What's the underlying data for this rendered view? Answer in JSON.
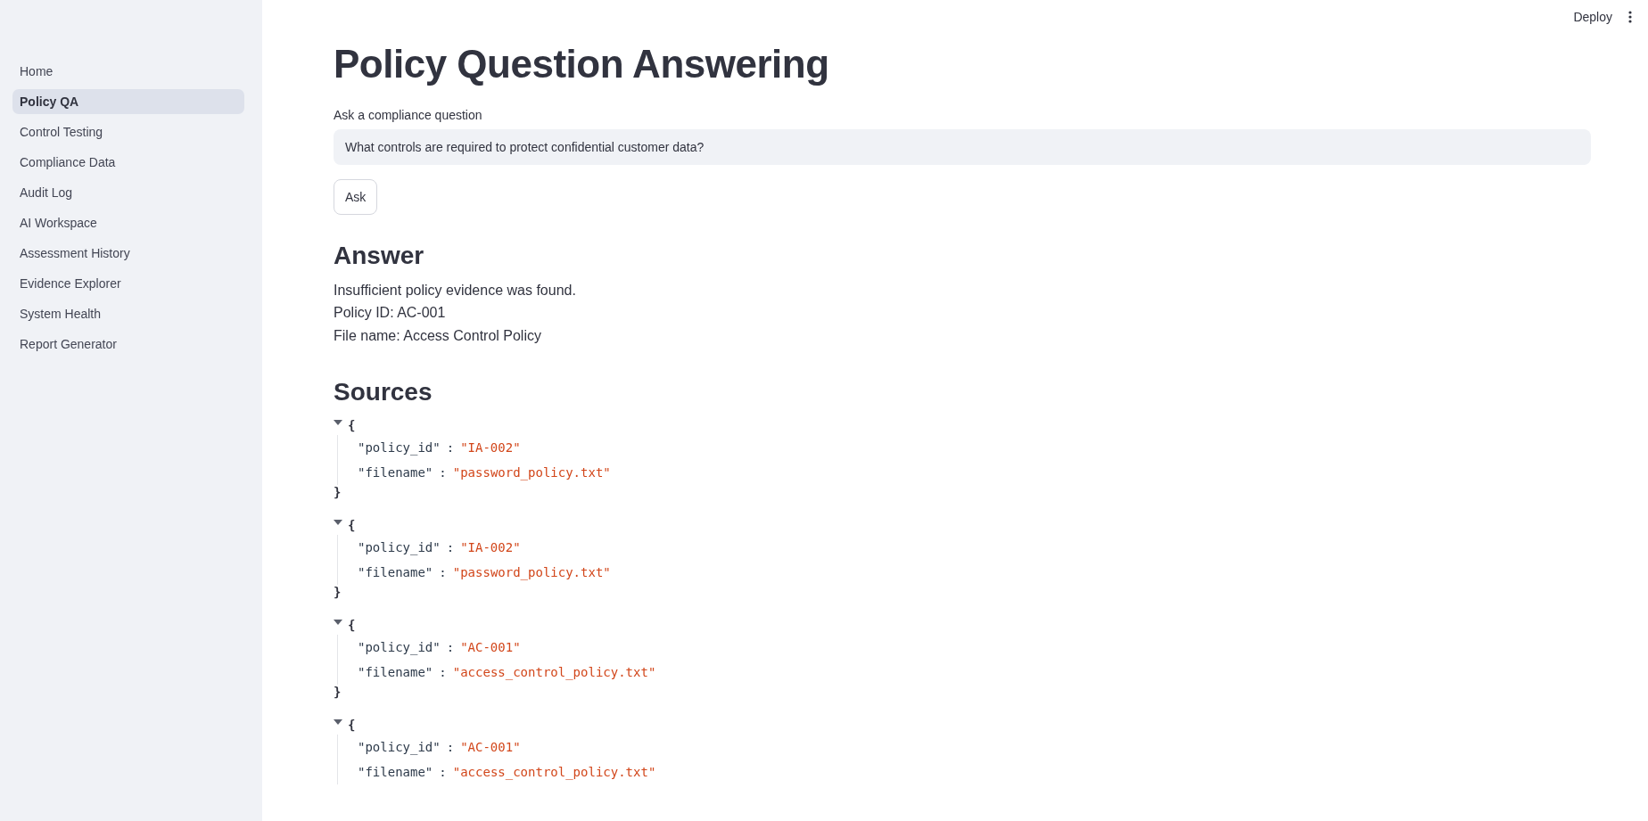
{
  "sidebar": {
    "items": [
      {
        "label": "Home",
        "selected": false
      },
      {
        "label": "Policy QA",
        "selected": true
      },
      {
        "label": "Control Testing",
        "selected": false
      },
      {
        "label": "Compliance Data",
        "selected": false
      },
      {
        "label": "Audit Log",
        "selected": false
      },
      {
        "label": "AI Workspace",
        "selected": false
      },
      {
        "label": "Assessment History",
        "selected": false
      },
      {
        "label": "Evidence Explorer",
        "selected": false
      },
      {
        "label": "System Health",
        "selected": false
      },
      {
        "label": "Report Generator",
        "selected": false
      }
    ]
  },
  "header": {
    "deploy": "Deploy"
  },
  "title": "Policy Question Answering",
  "question": {
    "label": "Ask a compliance question",
    "value": "What controls are required to protect confidential customer data?"
  },
  "ask_button": "Ask",
  "answer": {
    "heading": "Answer",
    "lines": [
      "Insufficient policy evidence was found.",
      "Policy ID: AC-001",
      "File name: Access Control Policy"
    ]
  },
  "sources": {
    "heading": "Sources",
    "items": [
      {
        "open": "{",
        "close": "}",
        "fields": [
          {
            "key": "\"policy_id\"",
            "sep": ":",
            "value": "\"IA-002\""
          },
          {
            "key": "\"filename\"",
            "sep": ":",
            "value": "\"password_policy.txt\""
          }
        ]
      },
      {
        "open": "{",
        "close": "}",
        "fields": [
          {
            "key": "\"policy_id\"",
            "sep": ":",
            "value": "\"IA-002\""
          },
          {
            "key": "\"filename\"",
            "sep": ":",
            "value": "\"password_policy.txt\""
          }
        ]
      },
      {
        "open": "{",
        "close": "}",
        "fields": [
          {
            "key": "\"policy_id\"",
            "sep": ":",
            "value": "\"AC-001\""
          },
          {
            "key": "\"filename\"",
            "sep": ":",
            "value": "\"access_control_policy.txt\""
          }
        ]
      },
      {
        "open": "{",
        "fields": [
          {
            "key": "\"policy_id\"",
            "sep": ":",
            "value": "\"AC-001\""
          },
          {
            "key": "\"filename\"",
            "sep": ":",
            "value": "\"access_control_policy.txt\""
          }
        ]
      }
    ]
  }
}
